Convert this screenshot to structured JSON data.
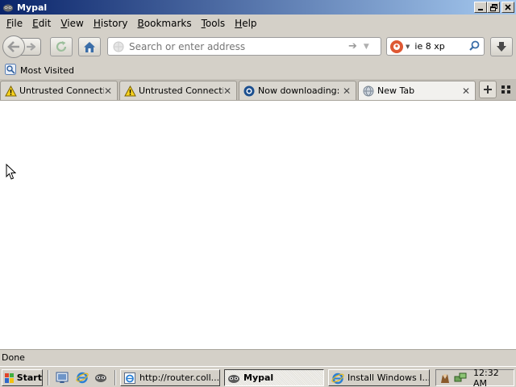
{
  "window": {
    "title": "Mypal",
    "controls": [
      "minimize",
      "restore",
      "close"
    ]
  },
  "menubar": {
    "items": [
      {
        "label": "File",
        "mnemonic": "F",
        "rest": "ile"
      },
      {
        "label": "Edit",
        "mnemonic": "E",
        "rest": "dit"
      },
      {
        "label": "View",
        "mnemonic": "V",
        "rest": "iew"
      },
      {
        "label": "History",
        "mnemonic": "H",
        "rest": "istory"
      },
      {
        "label": "Bookmarks",
        "mnemonic": "B",
        "rest": "ookmarks"
      },
      {
        "label": "Tools",
        "mnemonic": "T",
        "rest": "ools"
      },
      {
        "label": "Help",
        "mnemonic": "H",
        "rest": "elp"
      }
    ]
  },
  "navbar": {
    "back_icon": "arrow-left-icon",
    "forward_icon": "arrow-right-icon",
    "reload_icon": "reload-icon",
    "home_icon": "home-icon",
    "urlbar_placeholder": "Search or enter address",
    "urlbar_value": "",
    "search_engine": "DuckDuckGo",
    "search_value": "ie 8 xp",
    "download_icon": "download-arrow-icon"
  },
  "bookmarks": {
    "items": [
      {
        "label": "Most Visited",
        "icon": "most-visited-icon"
      }
    ]
  },
  "tabs": [
    {
      "label": "Untrusted Connecti...",
      "icon": "warning-icon",
      "active": false
    },
    {
      "label": "Untrusted Connecti...",
      "icon": "warning-icon",
      "active": false
    },
    {
      "label": "Now downloading: ...",
      "icon": "downloading-icon",
      "active": false
    },
    {
      "label": "New Tab",
      "icon": "globe-icon",
      "active": true
    }
  ],
  "status": {
    "text": "Done"
  },
  "taskbar": {
    "start_label": "Start",
    "tasks": [
      {
        "label": "http://router.coll...",
        "icon": "ie-page-icon",
        "active": false
      },
      {
        "label": "Mypal",
        "icon": "mypal-icon",
        "active": true
      },
      {
        "label": "Install Windows I...",
        "icon": "windows-install-icon",
        "active": false
      }
    ],
    "clock": "12:32 AM"
  },
  "colors": {
    "titlebar_start": "#0a246a",
    "titlebar_end": "#a6caf0",
    "chrome": "#d4d0c8",
    "content_bg": "#ffffff",
    "warning_yellow": "#f7d21d",
    "duckduckgo": "#de5833"
  }
}
